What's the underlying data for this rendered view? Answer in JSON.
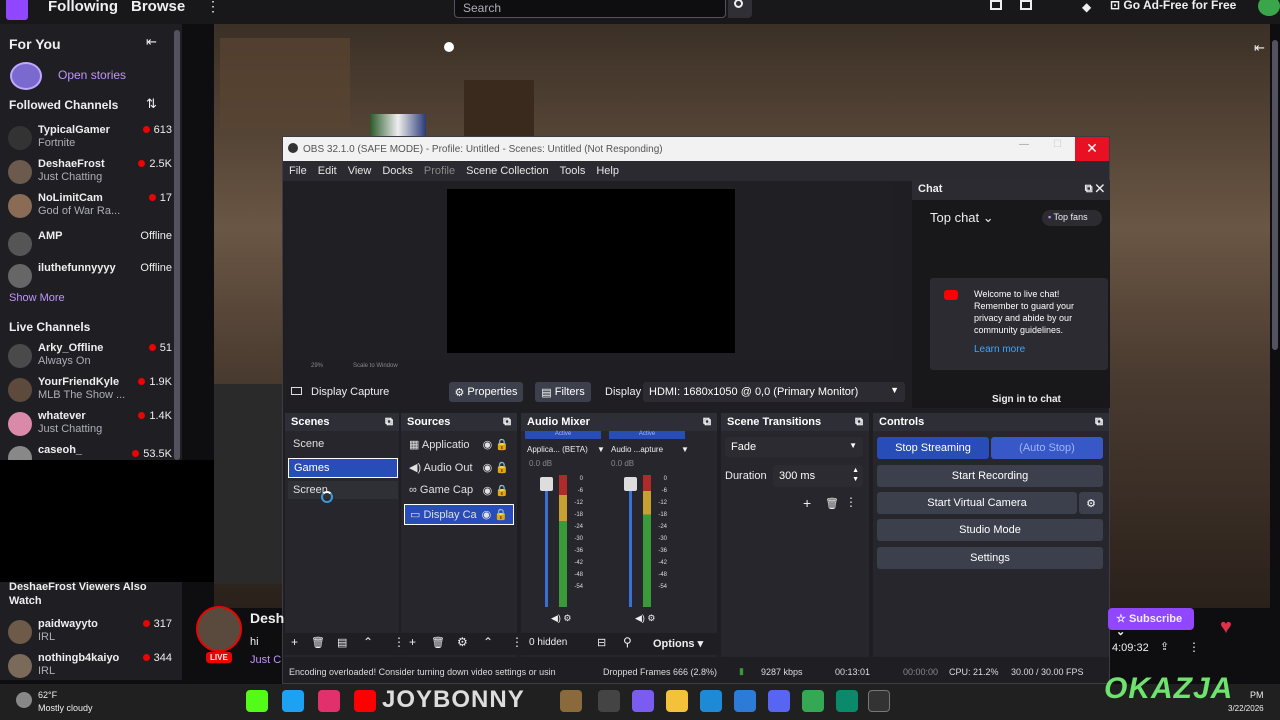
{
  "nav": {
    "following": "Following",
    "browse": "Browse",
    "search_placeholder": "Search",
    "ad_free": "Go Ad-Free for Free"
  },
  "sidebar": {
    "for_you": "For You",
    "open_stories": "Open stories",
    "followed_header": "Followed Channels",
    "followed": [
      {
        "name": "TypicalGamer",
        "game": "Fortnite",
        "viewers": "613"
      },
      {
        "name": "DeshaeFrost",
        "game": "Just Chatting",
        "viewers": "2.5K"
      },
      {
        "name": "NoLimitCam",
        "game": "God of War Ra...",
        "viewers": "17"
      },
      {
        "name": "AMP",
        "game": "",
        "viewers": "Offline"
      },
      {
        "name": "iluthefunnyyyy",
        "game": "",
        "viewers": "Offline"
      }
    ],
    "show_more": "Show More",
    "live_header": "Live Channels",
    "live": [
      {
        "name": "Arky_Offline",
        "game": "Always On",
        "viewers": "51"
      },
      {
        "name": "YourFriendKyle",
        "game": "MLB The Show ...",
        "viewers": "1.9K"
      },
      {
        "name": "whatever",
        "game": "Just Chatting",
        "viewers": "1.4K"
      },
      {
        "name": "caseoh_",
        "game": "",
        "viewers": "53.5K"
      }
    ],
    "also_watch": "DeshaeFrost Viewers Also Watch",
    "also": [
      {
        "name": "paidwayyto",
        "game": "IRL",
        "viewers": "317"
      },
      {
        "name": "nothingb4kaiyo",
        "game": "IRL",
        "viewers": "344"
      }
    ]
  },
  "obs": {
    "title": "OBS 32.1.0 (SAFE MODE) - Profile: Untitled - Scenes: Untitled (Not Responding)",
    "menu": [
      "File",
      "Edit",
      "View",
      "Docks",
      "Profile",
      "Scene Collection",
      "Tools",
      "Help"
    ],
    "zoom": "29%",
    "scale": "Scale to Window",
    "source_label": "Display Capture",
    "properties": "Properties",
    "filters": "Filters",
    "display_label": "Display",
    "display_value": "HDMI: 1680x1050 @ 0,0 (Primary Monitor)",
    "scenes_title": "Scenes",
    "scenes": [
      "Scene",
      "Games",
      "Screen"
    ],
    "sources_title": "Sources",
    "sources": [
      "Applicatio",
      "Audio Out",
      "Game Cap",
      "Display Ca"
    ],
    "mixer_title": "Audio Mixer",
    "mixer_ch1": "Applica... (BETA)",
    "mixer_ch2": "Audio ...apture",
    "active": "Active",
    "db": "0.0 dB",
    "meter_ticks": [
      "0",
      "-6",
      "-12",
      "-18",
      "-24",
      "-30",
      "-36",
      "-42",
      "-48",
      "-54"
    ],
    "transitions_title": "Scene Transitions",
    "transition": "Fade",
    "duration_label": "Duration",
    "duration": "300 ms",
    "controls_title": "Controls",
    "stop_streaming": "Stop Streaming",
    "auto_stop": "(Auto Stop)",
    "start_recording": "Start Recording",
    "start_virtual": "Start Virtual Camera",
    "studio_mode": "Studio Mode",
    "settings": "Settings",
    "hidden": "0 hidden",
    "options": "Options",
    "status_msg": "Encoding overloaded! Consider turning down video settings or usin",
    "dropped": "Dropped Frames 666 (2.8%)",
    "kbps": "9287 kbps",
    "stream_time": "00:13:01",
    "rec_time": "00:00:00",
    "cpu": "CPU: 21.2%",
    "fps": "30.00 / 30.00 FPS"
  },
  "chat": {
    "title": "Chat",
    "top_chat": "Top chat",
    "top_fans": "Top fans",
    "welcome": "Welcome to live chat! Remember to guard your privacy and abide by our community guidelines.",
    "learn_more": "Learn more",
    "sign_in": "Sign in to chat"
  },
  "stream": {
    "name": "Desh",
    "hi": "hi",
    "just": "Just C",
    "live": "LIVE",
    "subscribe": "Subscribe",
    "uptime": "4:09:32"
  },
  "weather": {
    "temp": "62°F",
    "desc": "Mostly cloudy"
  },
  "taskbar": {
    "overlay_text": "JOYBONNY",
    "date": "3/22/2026",
    "time": "PM",
    "watermark": "OKAZJA"
  },
  "colors": {
    "twitch_purple": "#9147ff",
    "obs_blue": "#284cb8",
    "live_red": "#eb0400"
  }
}
